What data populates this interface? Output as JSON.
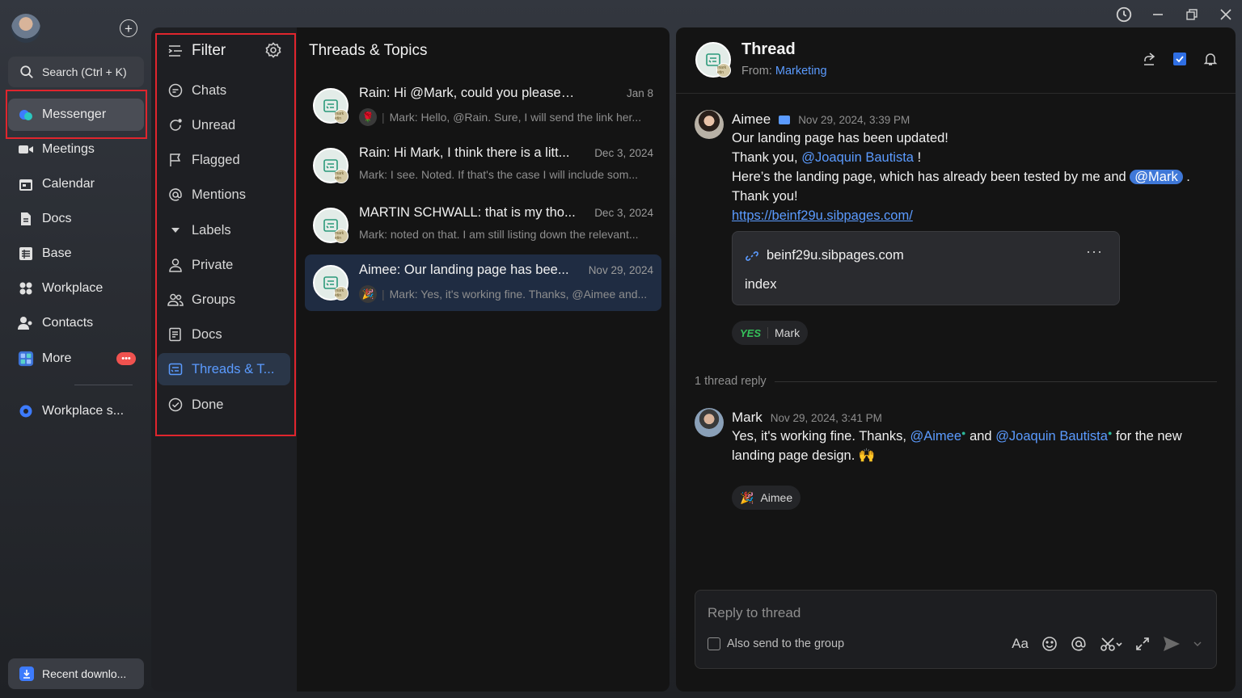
{
  "window": {
    "history_icon": "history-icon",
    "minimize_icon": "minimize-icon",
    "restore_icon": "restore-icon",
    "close_icon": "close-icon"
  },
  "nav": {
    "search_label": "Search (Ctrl + K)",
    "items": [
      {
        "label": "Messenger",
        "icon": "messenger-icon"
      },
      {
        "label": "Meetings",
        "icon": "video-icon"
      },
      {
        "label": "Calendar",
        "icon": "calendar-icon"
      },
      {
        "label": "Docs",
        "icon": "docs-icon"
      },
      {
        "label": "Base",
        "icon": "base-icon"
      },
      {
        "label": "Workplace",
        "icon": "workplace-icon"
      },
      {
        "label": "Contacts",
        "icon": "contacts-icon"
      },
      {
        "label": "More",
        "icon": "more-icon",
        "badge": "•••"
      },
      {
        "label": "Workplace s...",
        "icon": "settings-icon"
      }
    ],
    "recent_label": "Recent downlo..."
  },
  "filter": {
    "title": "Filter",
    "items": [
      {
        "label": "Chats"
      },
      {
        "label": "Unread"
      },
      {
        "label": "Flagged"
      },
      {
        "label": "Mentions"
      },
      {
        "label": "Labels"
      },
      {
        "label": "Private"
      },
      {
        "label": "Groups"
      },
      {
        "label": "Docs"
      },
      {
        "label": "Threads & T..."
      },
      {
        "label": "Done"
      }
    ]
  },
  "threads": {
    "title": "Threads & Topics",
    "rows": [
      {
        "title": "Rain: Hi @Mark, could you please send t...",
        "date": "Jan 8",
        "preview": "Mark: Hello, @Rain. Sure, I will send the link her...",
        "emoji": "🌹",
        "mini": "mark etin"
      },
      {
        "title": "Rain: Hi Mark, I think there is a litt...",
        "date": "Dec 3, 2024",
        "preview": "Mark: I see. Noted. If that's the case I will include som...",
        "emoji": "",
        "mini": "mark etin"
      },
      {
        "title": "MARTIN SCHWALL: that is my tho...",
        "date": "Dec 3, 2024",
        "preview": "Mark: noted on that. I am still listing down the relevant...",
        "emoji": "",
        "mini": "mark etin"
      },
      {
        "title": "Aimee: Our landing page has bee...",
        "date": "Nov 29, 2024",
        "preview": "Mark: Yes, it's working fine. Thanks, @Aimee and...",
        "emoji": "🎉",
        "mini": "mark etin"
      }
    ]
  },
  "detail": {
    "title": "Thread",
    "from_label": "From:",
    "from_value": "Marketing",
    "msg1": {
      "name": "Aimee",
      "time": "Nov 29, 2024, 3:39 PM",
      "line1": "Our landing page has been updated!",
      "line2a": "Thank you, ",
      "line2m": "@Joaquin Bautista",
      "line2b": " !",
      "line3a": "Here’s the landing page, which has already been tested by me and ",
      "line3m": "@Mark",
      "line3b": " .",
      "line4": "Thank you!",
      "link": "https://beinf29u.sibpages.com/",
      "card_domain": "beinf29u.sibpages.com",
      "card_title": "index",
      "card_more": "···",
      "reaction_emoji": "YES",
      "reaction_user": "Mark"
    },
    "replies_label": "1 thread reply",
    "msg2": {
      "name": "Mark",
      "time": "Nov 29, 2024, 3:41 PM",
      "l1a": "Yes, it's working fine. Thanks, ",
      "l1m1": "@Aimee",
      "l1b": " and ",
      "l1m2": "@Joaquin Bautista",
      "l1c": " for the new",
      "l2": "landing page design. 🙌",
      "reaction_emoji": "🎉",
      "reaction_user": "Aimee"
    },
    "composer": {
      "placeholder": "Reply to thread",
      "checkbox_label": "Also send to the group",
      "format_label": "Aa"
    }
  },
  "colors": {
    "accent": "#5b9bff",
    "highlight": "#e0252d",
    "active_row": "#1f2c42"
  }
}
